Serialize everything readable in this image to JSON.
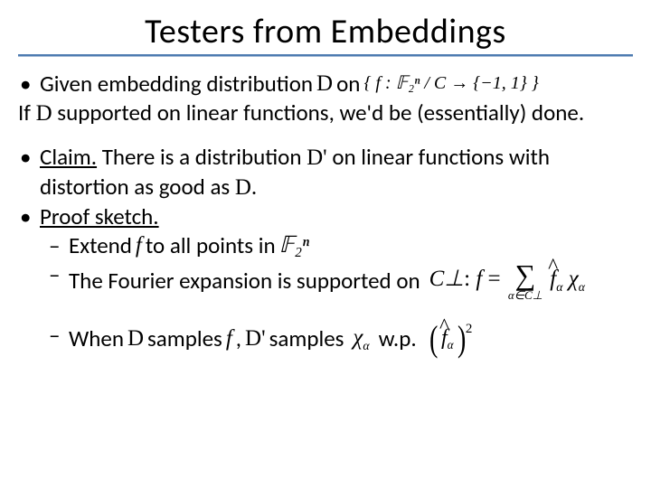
{
  "title": "Testers from Embeddings",
  "line1_prefix": "Given embedding distribution ",
  "sym_D": "D",
  "line1_on": " on ",
  "math_braces": "{ f : 𝔽₂ⁿ / C → {−1, 1} }",
  "line2_prefix": "If ",
  "line2_rest": " supported on linear functions, we'd be (essentially) done.",
  "claim_label": "Claim.",
  "claim_text_a": " There is a distribution ",
  "sym_Dp": "D'",
  "claim_text_b": " on linear functions with distortion as good as ",
  "period": ".",
  "proof_label": "Proof sketch.",
  "extend_a": "Extend ",
  "sym_f": "f",
  "extend_b": " to all points in ",
  "math_F2n": "𝔽₂ⁿ",
  "fourier_text": "The Fourier expansion is supported on ",
  "math_Cperp": "C⊥",
  "colon": ": ",
  "eq_f": "f",
  "eq_equals": " = ",
  "sum_lower": "α∈C⊥",
  "eq_fhat": "f",
  "eq_sub_alpha": "α",
  "eq_chi": "χ",
  "when_a": "When ",
  "when_b": " samples ",
  "when_c": ", ",
  "when_d": " samples ",
  "wp": "w.p.",
  "sq_two": "2"
}
